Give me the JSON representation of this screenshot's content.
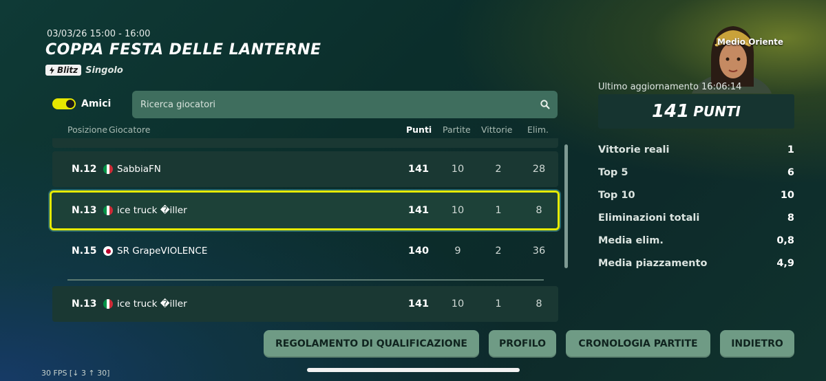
{
  "event": {
    "date": "03/03/26 15:00 - 16:00",
    "title": "COPPA FESTA DELLE LANTERNE",
    "mode_badge": "Blitz",
    "mode_type": "Singolo"
  },
  "filters": {
    "friends_label": "Amici",
    "friends_toggle_on": true,
    "search_placeholder": "Ricerca giocatori"
  },
  "table": {
    "headers": {
      "position": "Posizione",
      "player": "Giocatore",
      "points": "Punti",
      "matches": "Partite",
      "wins": "Vittorie",
      "elims": "Elim."
    },
    "rows": [
      {
        "pos": "N.12",
        "flag": "it",
        "name": "SabbiaFN",
        "points": "141",
        "matches": "10",
        "wins": "2",
        "elims": "28"
      },
      {
        "pos": "N.13",
        "flag": "it",
        "name": "ice truck �iller",
        "points": "141",
        "matches": "10",
        "wins": "1",
        "elims": "8"
      },
      {
        "pos": "N.15",
        "flag": "jp",
        "name": "SR GrapeVIOLENCE",
        "points": "140",
        "matches": "9",
        "wins": "2",
        "elims": "36"
      }
    ],
    "self_row": {
      "pos": "N.13",
      "flag": "it",
      "name": "ice truck �iller",
      "points": "141",
      "matches": "10",
      "wins": "1",
      "elims": "8"
    }
  },
  "profile": {
    "region": "Medio Oriente",
    "last_update": "Ultimo aggiornamento 16:06:14",
    "points_value": "141",
    "points_label": "PUNTI",
    "stats": [
      {
        "label": "Vittorie reali",
        "value": "1"
      },
      {
        "label": "Top 5",
        "value": "6"
      },
      {
        "label": "Top 10",
        "value": "10"
      },
      {
        "label": "Eliminazioni totali",
        "value": "8"
      },
      {
        "label": "Media elim.",
        "value": "0,8"
      },
      {
        "label": "Media piazzamento",
        "value": "4,9"
      }
    ]
  },
  "buttons": {
    "rules": "REGOLAMENTO DI QUALIFICAZIONE",
    "profile": "PROFILO",
    "history": "CRONOLOGIA PARTITE",
    "back": "INDIETRO"
  },
  "debug": {
    "fps": "30 FPS [↓ 3 ↑ 30]"
  },
  "colors": {
    "accent_yellow": "#e6ea00",
    "button_green": "#6f9b85",
    "search_bg": "#3f6e5e"
  }
}
